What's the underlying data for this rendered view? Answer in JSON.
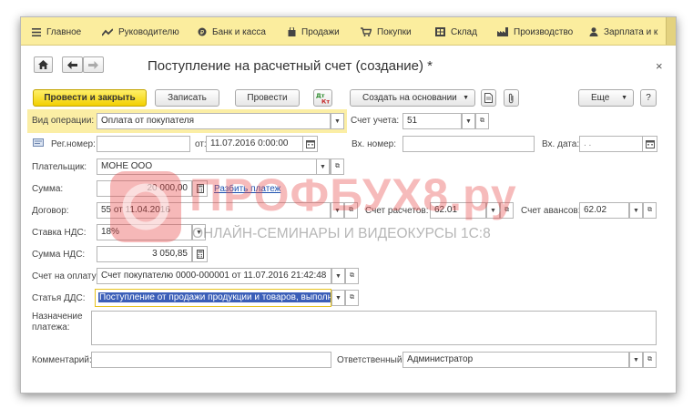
{
  "menu": [
    {
      "label": "Главное",
      "icon": "hamburger-icon"
    },
    {
      "label": "Руководителю",
      "icon": "chart-line-icon"
    },
    {
      "label": "Банк и касса",
      "icon": "coin-icon"
    },
    {
      "label": "Продажи",
      "icon": "shopping-bag-icon"
    },
    {
      "label": "Покупки",
      "icon": "cart-icon"
    },
    {
      "label": "Склад",
      "icon": "warehouse-icon"
    },
    {
      "label": "Производство",
      "icon": "factory-icon"
    },
    {
      "label": "Зарплата и к",
      "icon": "person-icon"
    }
  ],
  "window": {
    "title": "Поступление на расчетный счет (создание) *",
    "close": "×"
  },
  "toolbar": {
    "post_close": "Провести и закрыть",
    "save": "Записать",
    "post": "Провести",
    "create_based": "Создать на основании",
    "more": "Еще",
    "help": "?"
  },
  "form": {
    "operation_label": "Вид операции:",
    "operation_value": "Оплата от покупателя",
    "account_label": "Счет учета:",
    "account_value": "51",
    "regnum_label": "Рег.номер:",
    "from_label": "от:",
    "date_value": "11.07.2016  0:00:00",
    "in_num_label": "Вх. номер:",
    "in_date_label": "Вх. дата:",
    "in_date_value": " .  .",
    "payer_label": "Плательщик:",
    "payer_value": "МОНЕ ООО",
    "sum_label": "Сумма:",
    "sum_value": "20 000,00",
    "split_link": "Разбить платеж",
    "contract_label": "Договор:",
    "contract_value": "55 от 11.04.2016",
    "settle_label": "Счет расчетов:",
    "settle_value": "62.01",
    "advance_label": "Счет авансов:",
    "advance_value": "62.02",
    "vat_rate_label": "Ставка НДС:",
    "vat_rate_value": "18%",
    "vat_sum_label": "Сумма НДС:",
    "vat_sum_value": "3 050,85",
    "invoice_label": "Счет на оплату:",
    "invoice_value": "Счет покупателю 0000-000001 от 11.07.2016 21:42:48",
    "dds_label": "Статья ДДС:",
    "dds_value": "Поступление от продажи продукции и товаров, выполнения",
    "purpose_label_1": "Назначение",
    "purpose_label_2": "платежа:",
    "comment_label": "Комментарий:",
    "responsible_label": "Ответственный:",
    "responsible_value": "Администратор"
  },
  "watermark": {
    "brand": "ПРОФБУХ8.ру",
    "tagline": "ОНЛАЙН-СЕМИНАРЫ И ВИДЕОКУРСЫ 1С:8",
    "color": "#e84545"
  }
}
